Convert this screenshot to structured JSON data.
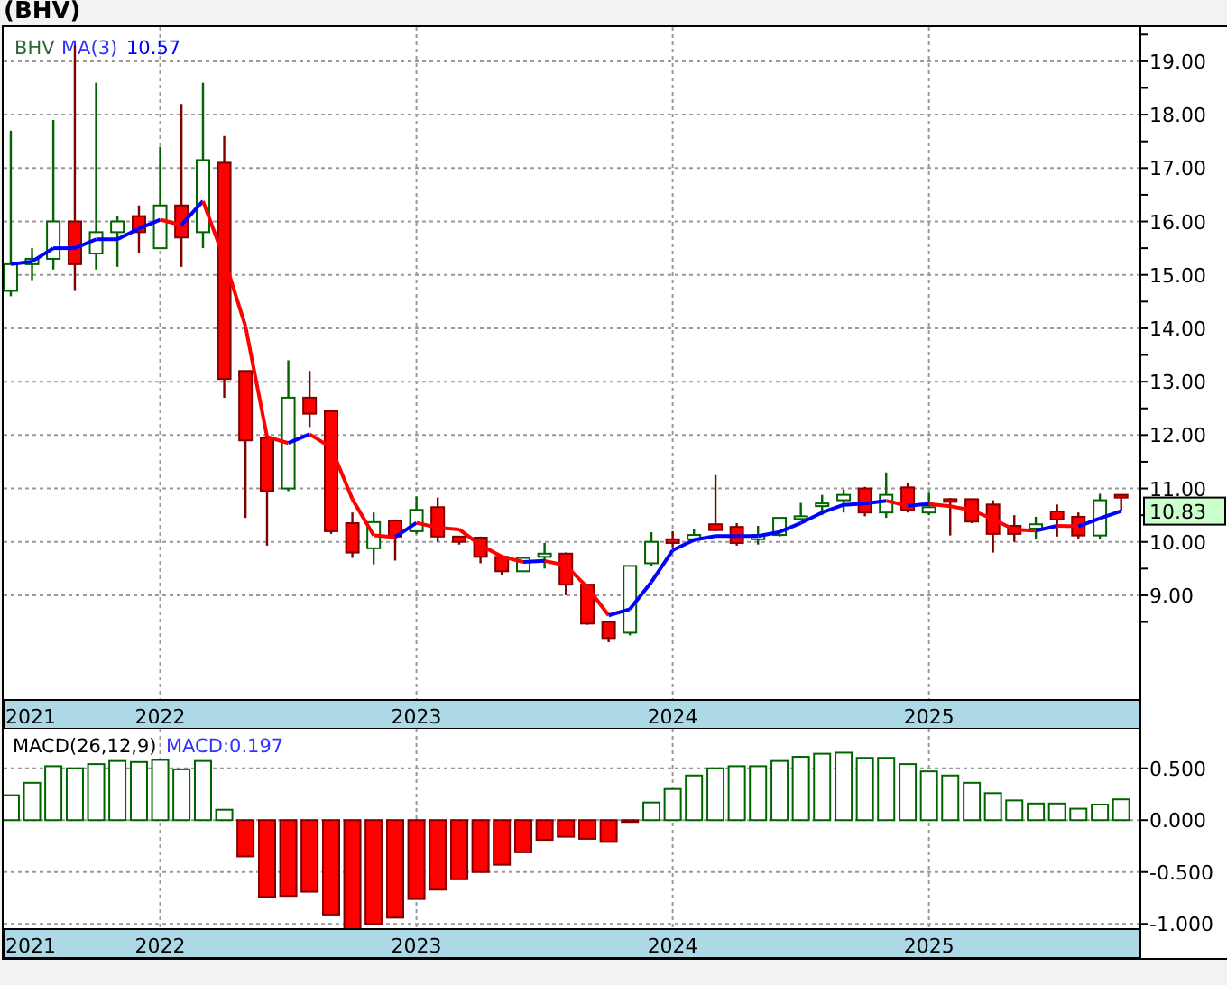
{
  "title": "(BHV)",
  "price_panel": {
    "legend": {
      "symbol": "BHV",
      "indicator": "MA(3)",
      "value": "10.57"
    },
    "last_price": "10.83",
    "chart_data": {
      "type": "candlestick",
      "grid": true,
      "xlim": [
        2021.389,
        2025.825
      ],
      "ylim": [
        7.04,
        19.64
      ],
      "x": [
        2021.417,
        2021.5,
        2021.583,
        2021.667,
        2021.75,
        2021.833,
        2021.917,
        2022.0,
        2022.083,
        2022.167,
        2022.25,
        2022.333,
        2022.417,
        2022.5,
        2022.583,
        2022.667,
        2022.75,
        2022.833,
        2022.917,
        2023.0,
        2023.083,
        2023.167,
        2023.25,
        2023.333,
        2023.417,
        2023.5,
        2023.583,
        2023.667,
        2023.75,
        2023.833,
        2023.917,
        2024.0,
        2024.083,
        2024.167,
        2024.25,
        2024.333,
        2024.417,
        2024.5,
        2024.583,
        2024.667,
        2024.75,
        2024.833,
        2024.917,
        2025.0,
        2025.083,
        2025.167,
        2025.25,
        2025.333,
        2025.417,
        2025.5,
        2025.583,
        2025.667,
        2025.75
      ],
      "xticks": [
        {
          "value": 2021.389,
          "label": "2021"
        },
        2022,
        2023,
        2024,
        2025
      ],
      "yticks": [
        {
          "value": 9,
          "label": "9.00"
        },
        {
          "value": 10,
          "label": "10.00"
        },
        {
          "value": 11,
          "label": "11.00"
        },
        {
          "value": 12,
          "label": "12.00"
        },
        {
          "value": 13,
          "label": "13.00"
        },
        {
          "value": 14,
          "label": "14.00"
        },
        {
          "value": 15,
          "label": "15.00"
        },
        {
          "value": 16,
          "label": "16.00"
        },
        {
          "value": 17,
          "label": "17.00"
        },
        {
          "value": 18,
          "label": "18.00"
        },
        {
          "value": 19,
          "label": "19.00"
        }
      ],
      "ohlc": [
        [
          14.7,
          17.7,
          14.6,
          15.2
        ],
        [
          15.2,
          15.5,
          14.9,
          15.3
        ],
        [
          15.3,
          17.9,
          15.1,
          16.0
        ],
        [
          16.0,
          19.3,
          14.7,
          15.2
        ],
        [
          15.4,
          18.6,
          15.1,
          15.8
        ],
        [
          15.8,
          16.1,
          15.15,
          16.0
        ],
        [
          16.1,
          16.3,
          15.4,
          15.8
        ],
        [
          15.5,
          17.4,
          15.5,
          16.3
        ],
        [
          16.3,
          18.2,
          15.15,
          15.7
        ],
        [
          15.8,
          18.6,
          15.5,
          17.15
        ],
        [
          17.1,
          17.6,
          12.7,
          13.05
        ],
        [
          13.2,
          13.2,
          10.45,
          11.9
        ],
        [
          11.95,
          11.95,
          9.93,
          10.95
        ],
        [
          11.0,
          13.4,
          10.95,
          12.7
        ],
        [
          12.7,
          13.2,
          12.15,
          12.4
        ],
        [
          12.45,
          12.45,
          10.15,
          10.2
        ],
        [
          10.35,
          10.55,
          9.7,
          9.8
        ],
        [
          9.88,
          10.55,
          9.58,
          10.37
        ],
        [
          10.4,
          10.42,
          9.65,
          10.1
        ],
        [
          10.2,
          10.85,
          10.15,
          10.6
        ],
        [
          10.65,
          10.83,
          10.0,
          10.1
        ],
        [
          10.1,
          10.1,
          9.95,
          10.0
        ],
        [
          10.08,
          10.1,
          9.6,
          9.72
        ],
        [
          9.72,
          9.75,
          9.38,
          9.45
        ],
        [
          9.45,
          9.72,
          9.45,
          9.7
        ],
        [
          9.72,
          9.98,
          9.5,
          9.78
        ],
        [
          9.78,
          9.8,
          9.0,
          9.2
        ],
        [
          9.2,
          9.2,
          8.45,
          8.47
        ],
        [
          8.5,
          8.5,
          8.12,
          8.2
        ],
        [
          8.3,
          9.55,
          8.25,
          9.55
        ],
        [
          9.6,
          10.18,
          9.55,
          10.0
        ],
        [
          10.05,
          10.2,
          9.9,
          9.98
        ],
        [
          10.05,
          10.25,
          10.0,
          10.13
        ],
        [
          10.33,
          11.25,
          10.2,
          10.22
        ],
        [
          10.28,
          10.35,
          9.93,
          9.98
        ],
        [
          10.05,
          10.3,
          9.95,
          10.13
        ],
        [
          10.13,
          10.45,
          10.1,
          10.45
        ],
        [
          10.43,
          10.73,
          10.42,
          10.48
        ],
        [
          10.68,
          10.88,
          10.5,
          10.72
        ],
        [
          10.78,
          10.98,
          10.55,
          10.88
        ],
        [
          11.0,
          11.03,
          10.48,
          10.55
        ],
        [
          10.55,
          11.3,
          10.45,
          10.88
        ],
        [
          11.02,
          11.1,
          10.55,
          10.6
        ],
        [
          10.55,
          10.92,
          10.5,
          10.65
        ],
        [
          10.8,
          10.82,
          10.12,
          10.75
        ],
        [
          10.8,
          10.8,
          10.35,
          10.38
        ],
        [
          10.7,
          10.78,
          9.8,
          10.15
        ],
        [
          10.3,
          10.5,
          10.0,
          10.15
        ],
        [
          10.25,
          10.47,
          10.05,
          10.33
        ],
        [
          10.57,
          10.7,
          10.1,
          10.42
        ],
        [
          10.47,
          10.55,
          10.05,
          10.12
        ],
        [
          10.12,
          10.9,
          10.05,
          10.78
        ],
        [
          10.88,
          10.88,
          10.57,
          10.83
        ]
      ]
    }
  },
  "macd_panel": {
    "legend": {
      "name": "MACD(26,12,9)",
      "value": "MACD:0.197"
    },
    "chart_data": {
      "type": "bar",
      "grid": true,
      "xlim": [
        2021.389,
        2025.825
      ],
      "ylim": [
        -1.05,
        0.88
      ],
      "x": [
        2021.417,
        2021.5,
        2021.583,
        2021.667,
        2021.75,
        2021.833,
        2021.917,
        2022.0,
        2022.083,
        2022.167,
        2022.25,
        2022.333,
        2022.417,
        2022.5,
        2022.583,
        2022.667,
        2022.75,
        2022.833,
        2022.917,
        2023.0,
        2023.083,
        2023.167,
        2023.25,
        2023.333,
        2023.417,
        2023.5,
        2023.583,
        2023.667,
        2023.75,
        2023.833,
        2023.917,
        2024.0,
        2024.083,
        2024.167,
        2024.25,
        2024.333,
        2024.417,
        2024.5,
        2024.583,
        2024.667,
        2024.75,
        2024.833,
        2024.917,
        2025.0,
        2025.083,
        2025.167,
        2025.25,
        2025.333,
        2025.417,
        2025.5,
        2025.583,
        2025.667,
        2025.75
      ],
      "xticks": [
        {
          "value": 2021.389,
          "label": "2021"
        },
        2022,
        2023,
        2024,
        2025
      ],
      "yticks": [
        {
          "value": 0.5,
          "label": "0.500"
        },
        {
          "value": 0,
          "label": "0.000"
        },
        {
          "value": -0.5,
          "label": "-0.500"
        },
        {
          "value": -1,
          "label": "-1.000"
        }
      ],
      "values": [
        0.24,
        0.36,
        0.52,
        0.5,
        0.54,
        0.57,
        0.56,
        0.58,
        0.49,
        0.57,
        0.1,
        -0.35,
        -0.74,
        -0.73,
        -0.69,
        -0.91,
        -1.05,
        -1.0,
        -0.94,
        -0.76,
        -0.67,
        -0.57,
        -0.5,
        -0.43,
        -0.31,
        -0.19,
        -0.16,
        -0.18,
        -0.21,
        -0.01,
        0.17,
        0.3,
        0.43,
        0.5,
        0.52,
        0.52,
        0.57,
        0.61,
        0.64,
        0.65,
        0.6,
        0.6,
        0.54,
        0.47,
        0.43,
        0.36,
        0.26,
        0.19,
        0.16,
        0.16,
        0.11,
        0.15,
        0.2
      ]
    }
  }
}
